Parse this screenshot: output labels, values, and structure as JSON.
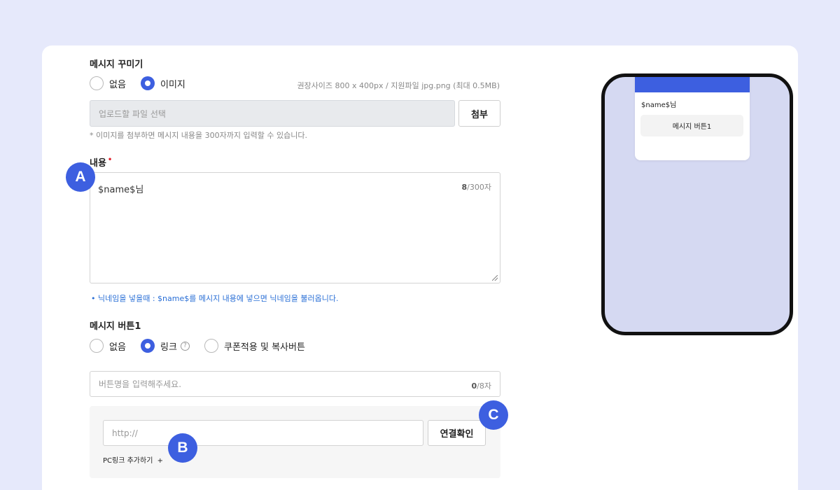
{
  "decoration": {
    "title": "메시지 꾸미기",
    "options": [
      "없음",
      "이미지"
    ],
    "selected": "이미지",
    "size_hint": "권장사이즈 800 x 400px / 지원파일 jpg.png (최대 0.5MB)",
    "file_placeholder": "업로드할 파일 선택",
    "attach_label": "첨부",
    "note": "* 이미지를 첨부하면 메시지 내용을 300자까지 입력할 수 있습니다."
  },
  "content": {
    "title": "내용",
    "required_mark": "•",
    "value": "$name$님",
    "count": "8",
    "max": "/300자",
    "tip": "• 닉네임을 넣을때 : $name$를 메시지 내용에 넣으면 닉네임을 불러옵니다."
  },
  "message_button": {
    "title": "메시지 버튼1",
    "options": [
      "없음",
      "링크",
      "쿠폰적용 및 복사버튼"
    ],
    "selected": "링크",
    "help_icon": "question-circle-icon",
    "name_placeholder": "버튼명을 입력해주세요.",
    "name_count": "0",
    "name_max": "/8자",
    "url_placeholder": "http://",
    "verify_label": "연결확인",
    "pc_link_label": "PC링크 추가하기",
    "pc_link_plus": "+"
  },
  "badges": [
    "A",
    "B",
    "C"
  ],
  "preview": {
    "text": "$name$님",
    "button_label": "메시지 버튼1"
  },
  "colors": {
    "accent": "#3d5fe0",
    "background": "#e6e9fb",
    "tip": "#2a6fd6"
  }
}
